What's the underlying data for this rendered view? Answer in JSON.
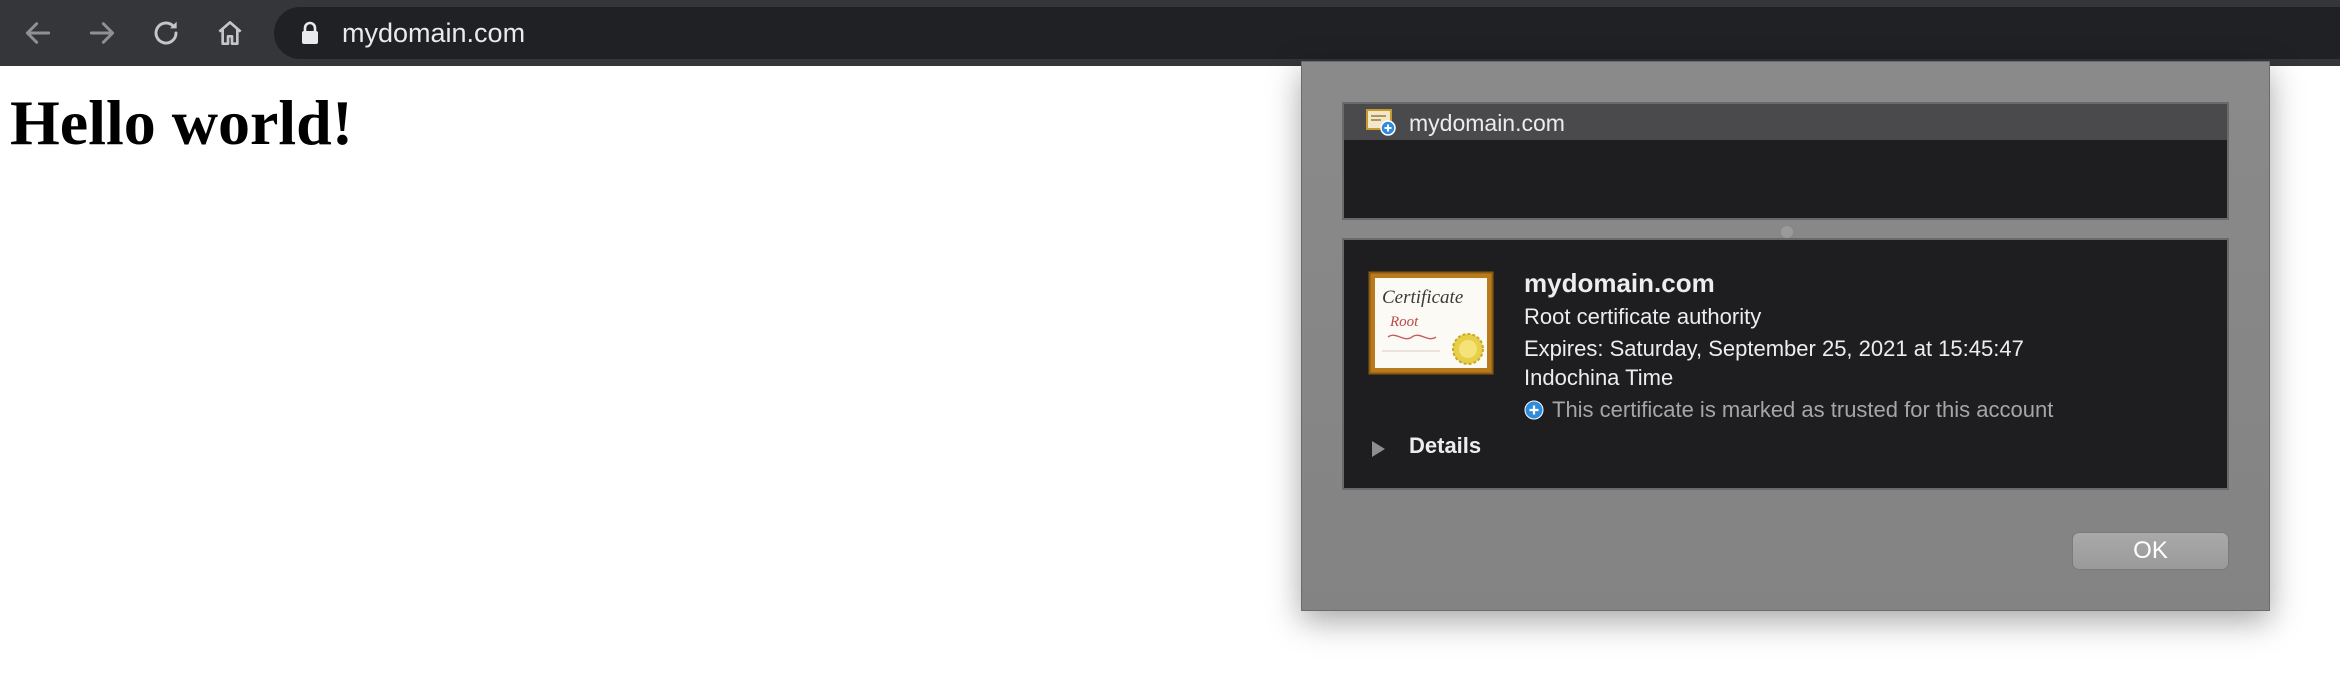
{
  "browser": {
    "url": "mydomain.com",
    "icons": {
      "back": "arrow-left-icon",
      "forward": "arrow-right-icon",
      "reload": "reload-icon",
      "home": "home-icon",
      "secure": "lock-icon"
    },
    "colors": {
      "toolbar": "#35363a",
      "omnibox": "#202124"
    }
  },
  "page": {
    "heading": "Hello world!"
  },
  "certificate_sheet": {
    "list": [
      {
        "name": "mydomain.com",
        "icon": "certificate-icon",
        "selected": true
      }
    ],
    "detail": {
      "image_icon": "certificate-image-icon",
      "image_lettering": [
        "Certificate",
        "Root"
      ],
      "name": "mydomain.com",
      "kind": "Root certificate authority",
      "expires_line1": "Expires: Saturday, September 25, 2021 at 15:45:47",
      "expires_line2": "Indochina Time",
      "trust_icon": "plus-circle-icon",
      "trust_text": "This certificate is marked as trusted for this account",
      "details_label": "Details"
    },
    "ok_label": "OK"
  }
}
